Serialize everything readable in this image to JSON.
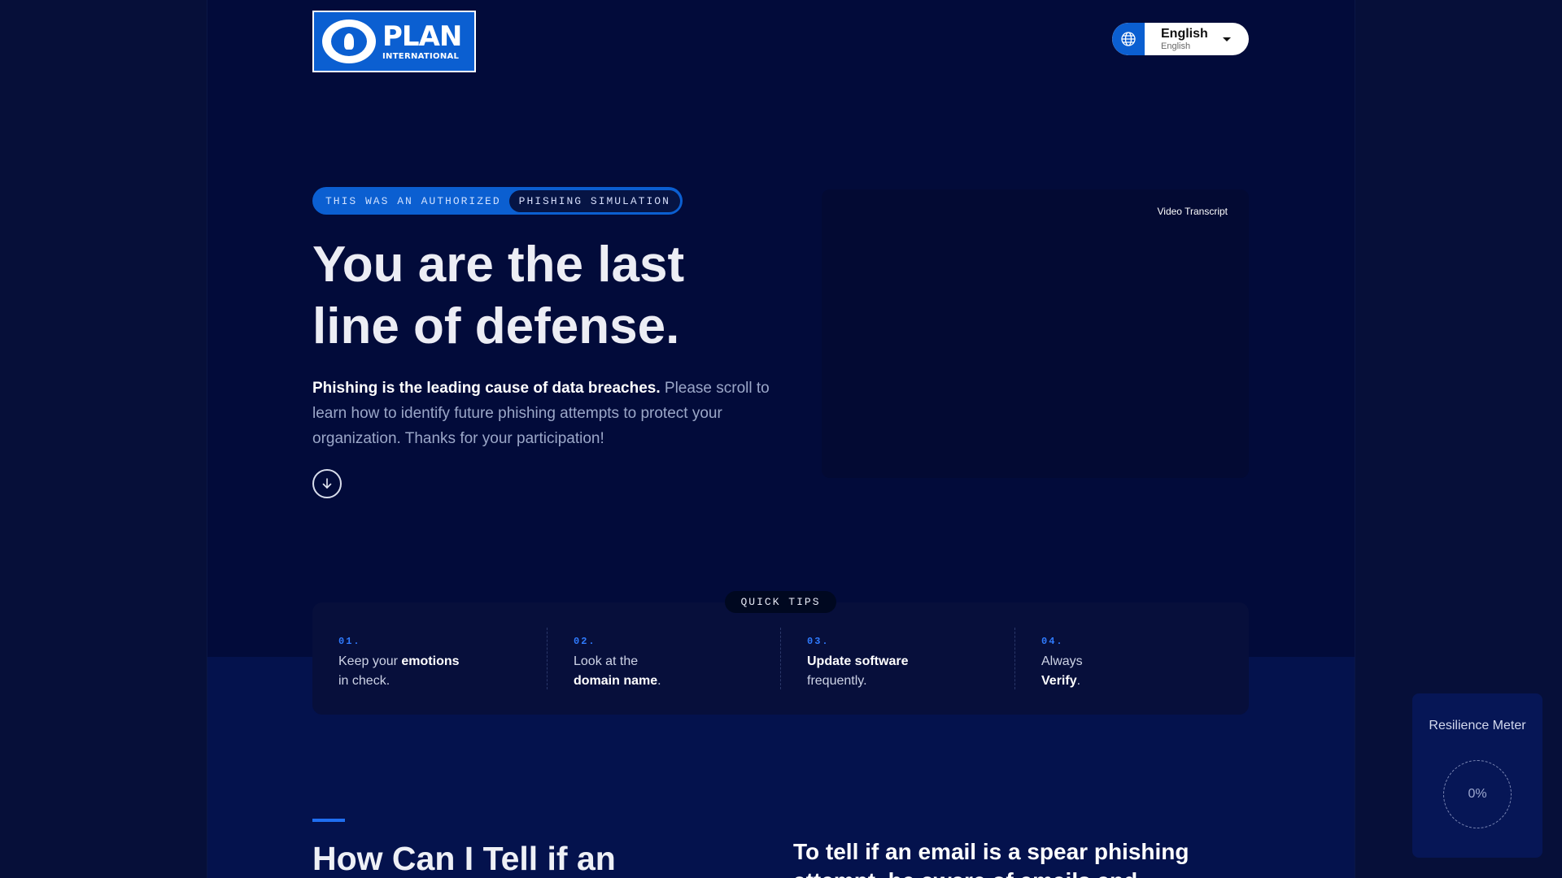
{
  "header": {
    "logo": {
      "big": "PLAN",
      "small": "INTERNATIONAL"
    },
    "language": {
      "selected": "English",
      "native": "English",
      "icon": "globe-icon"
    }
  },
  "hero": {
    "pill_left": "THIS WAS AN AUTHORIZED",
    "pill_right": "PHISHING SIMULATION",
    "title_line1": "You are the last",
    "title_line2": "line of defense.",
    "body_bold": "Phishing is the leading cause of data breaches.",
    "body_rest": "Please scroll to learn how to identify future phishing attempts to protect your organization. Thanks for your participation!",
    "scroll_icon": "arrow-down-icon"
  },
  "video": {
    "transcript_label": "Video Transcript"
  },
  "quick_tips": {
    "label": "QUICK TIPS",
    "tips": [
      {
        "num": "01.",
        "pre": "Keep your ",
        "bold": "emotions",
        "post": " in check."
      },
      {
        "num": "02.",
        "pre": "Look at the ",
        "bold": "domain name",
        "post": "."
      },
      {
        "num": "03.",
        "pre": "",
        "bold": "Update software",
        "post": " frequently."
      },
      {
        "num": "04.",
        "pre": "Always ",
        "bold": "Verify",
        "post": "."
      }
    ]
  },
  "section": {
    "left_title": "How Can I Tell if an",
    "right_title": "To tell if an email is a spear phishing attempt, be aware of emails and"
  },
  "meter": {
    "title": "Resilience Meter",
    "value": "0%"
  },
  "colors": {
    "accent": "#0b5fd1",
    "bg": "#020b3a",
    "tip_num": "#2f7bff"
  }
}
